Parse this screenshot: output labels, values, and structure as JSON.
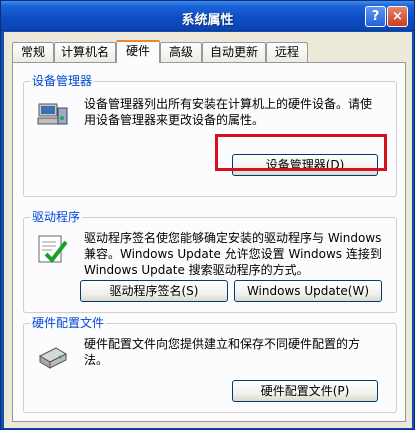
{
  "window": {
    "title": "系统属性",
    "help": "?",
    "close": "×"
  },
  "tabs": [
    {
      "label": "常规"
    },
    {
      "label": "计算机名"
    },
    {
      "label": "硬件"
    },
    {
      "label": "高级"
    },
    {
      "label": "自动更新"
    },
    {
      "label": "远程"
    }
  ],
  "device_manager": {
    "title": "设备管理器",
    "desc_line1": "设备管理器列出所有安装在计算机上的硬件设备。请使",
    "desc_line2": "用设备管理器来更改设备的属性。",
    "button": "设备管理器(D)"
  },
  "drivers": {
    "title": "驱动程序",
    "desc_line1": "驱动程序签名使您能够确定安装的驱动程序与 Windows",
    "desc_line2": "兼容。Windows Update 允许您设置 Windows 连接到",
    "desc_line3": "Windows Update 搜索驱动程序的方式。",
    "sign_button": "驱动程序签名(S)",
    "update_button": "Windows Update(W)"
  },
  "hw_profiles": {
    "title": "硬件配置文件",
    "desc_line1": "硬件配置文件向您提供建立和保存不同硬件配置的方",
    "desc_line2": "法。",
    "button": "硬件配置文件(P)"
  },
  "colors": {
    "accent": "#0046d5",
    "highlight": "#d4121c",
    "titlebar": "#0d4cc3"
  },
  "icons": [
    "device-manager-icon",
    "driver-signing-icon",
    "hardware-profile-icon"
  ]
}
